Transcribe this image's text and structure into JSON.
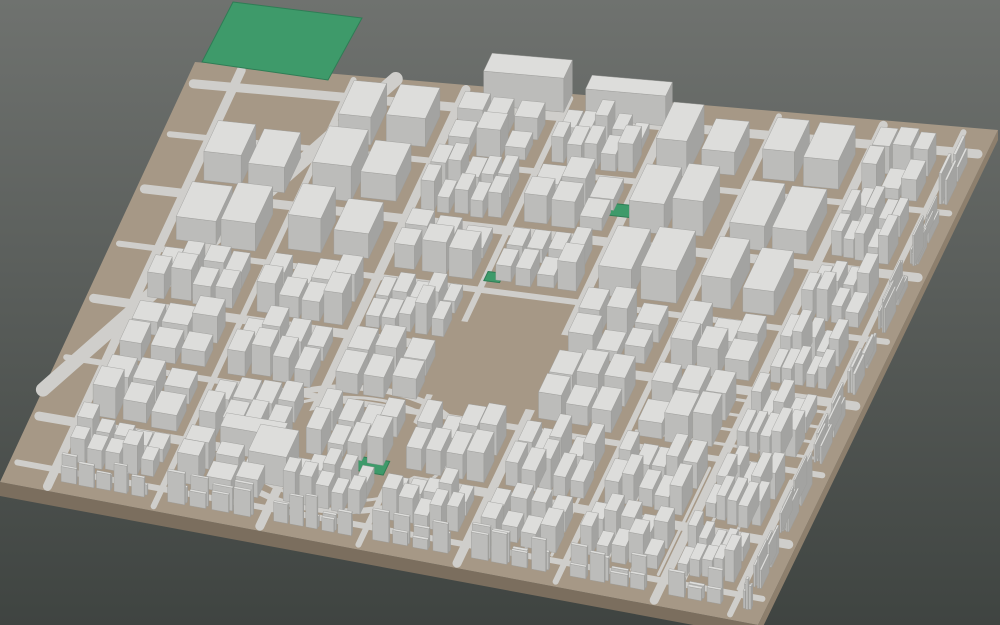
{
  "scene": {
    "kind": "isometric-3d-city-block-model",
    "colors": {
      "background_top": "#6f726f",
      "background_bottom": "#3f4441",
      "ground": "#a69886",
      "ground_side": "#8d7f6d",
      "ground_front": "#7b6e5e",
      "road": "#cfcecb",
      "building_top": "#dddddb",
      "building_left": "#bcbcba",
      "building_right": "#a3a3a1",
      "park": "#3e9a6a",
      "park_edge": "#2f7d55"
    }
  }
}
